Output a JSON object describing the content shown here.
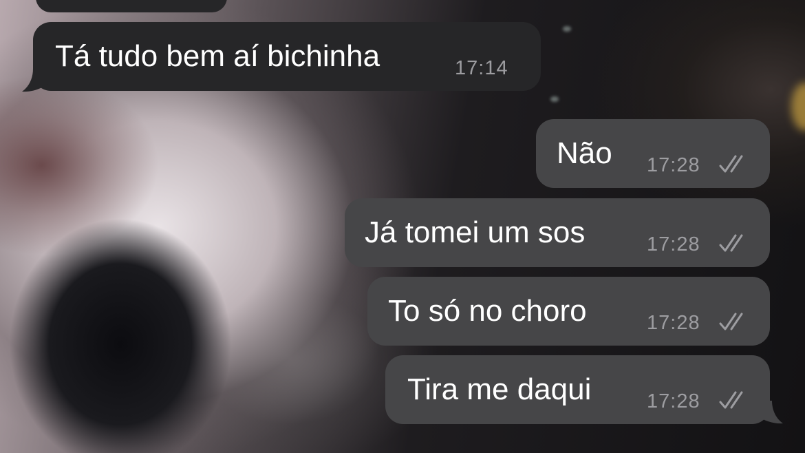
{
  "chat": {
    "incoming": [
      {
        "text": "",
        "time": ""
      },
      {
        "text": "Tá tudo bem aí bichinha",
        "time": "17:14"
      }
    ],
    "outgoing": [
      {
        "text": "Não",
        "time": "17:28",
        "status": "read"
      },
      {
        "text": "Já tomei um sos",
        "time": "17:28",
        "status": "read"
      },
      {
        "text": "To só no choro",
        "time": "17:28",
        "status": "read"
      },
      {
        "text": "Tira me daqui",
        "time": "17:28",
        "status": "read"
      }
    ]
  },
  "icons": {
    "read_receipt": "double-check-icon"
  },
  "colors": {
    "incoming_bubble": "#262628",
    "outgoing_bubble": "#464648",
    "timestamp": "#9d9da1"
  }
}
